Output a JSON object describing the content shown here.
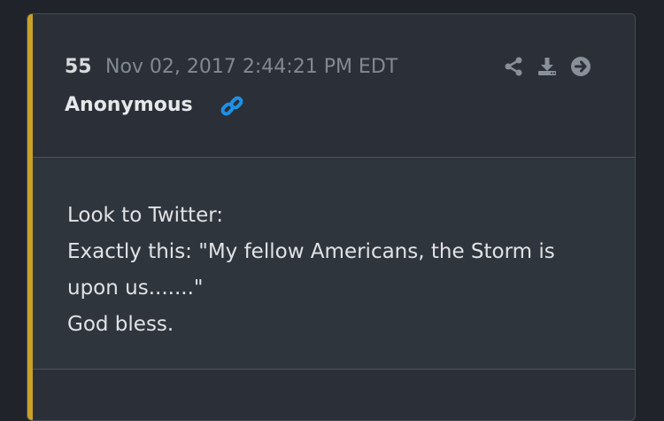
{
  "post": {
    "number": "55",
    "timestamp": "Nov 02, 2017 2:44:21 PM EDT",
    "author": "Anonymous",
    "message_lines": [
      "Look to Twitter:",
      "Exactly this: \"My fellow Americans, the Storm is",
      "upon us.......\"",
      "God bless."
    ]
  },
  "actions": [
    {
      "icon": "share-icon"
    },
    {
      "icon": "download-icon"
    },
    {
      "icon": "arrow-right-circle-icon"
    }
  ],
  "colors": {
    "accent": "#c9a227",
    "link": "#1e90e6",
    "icon": "#8a9099"
  }
}
